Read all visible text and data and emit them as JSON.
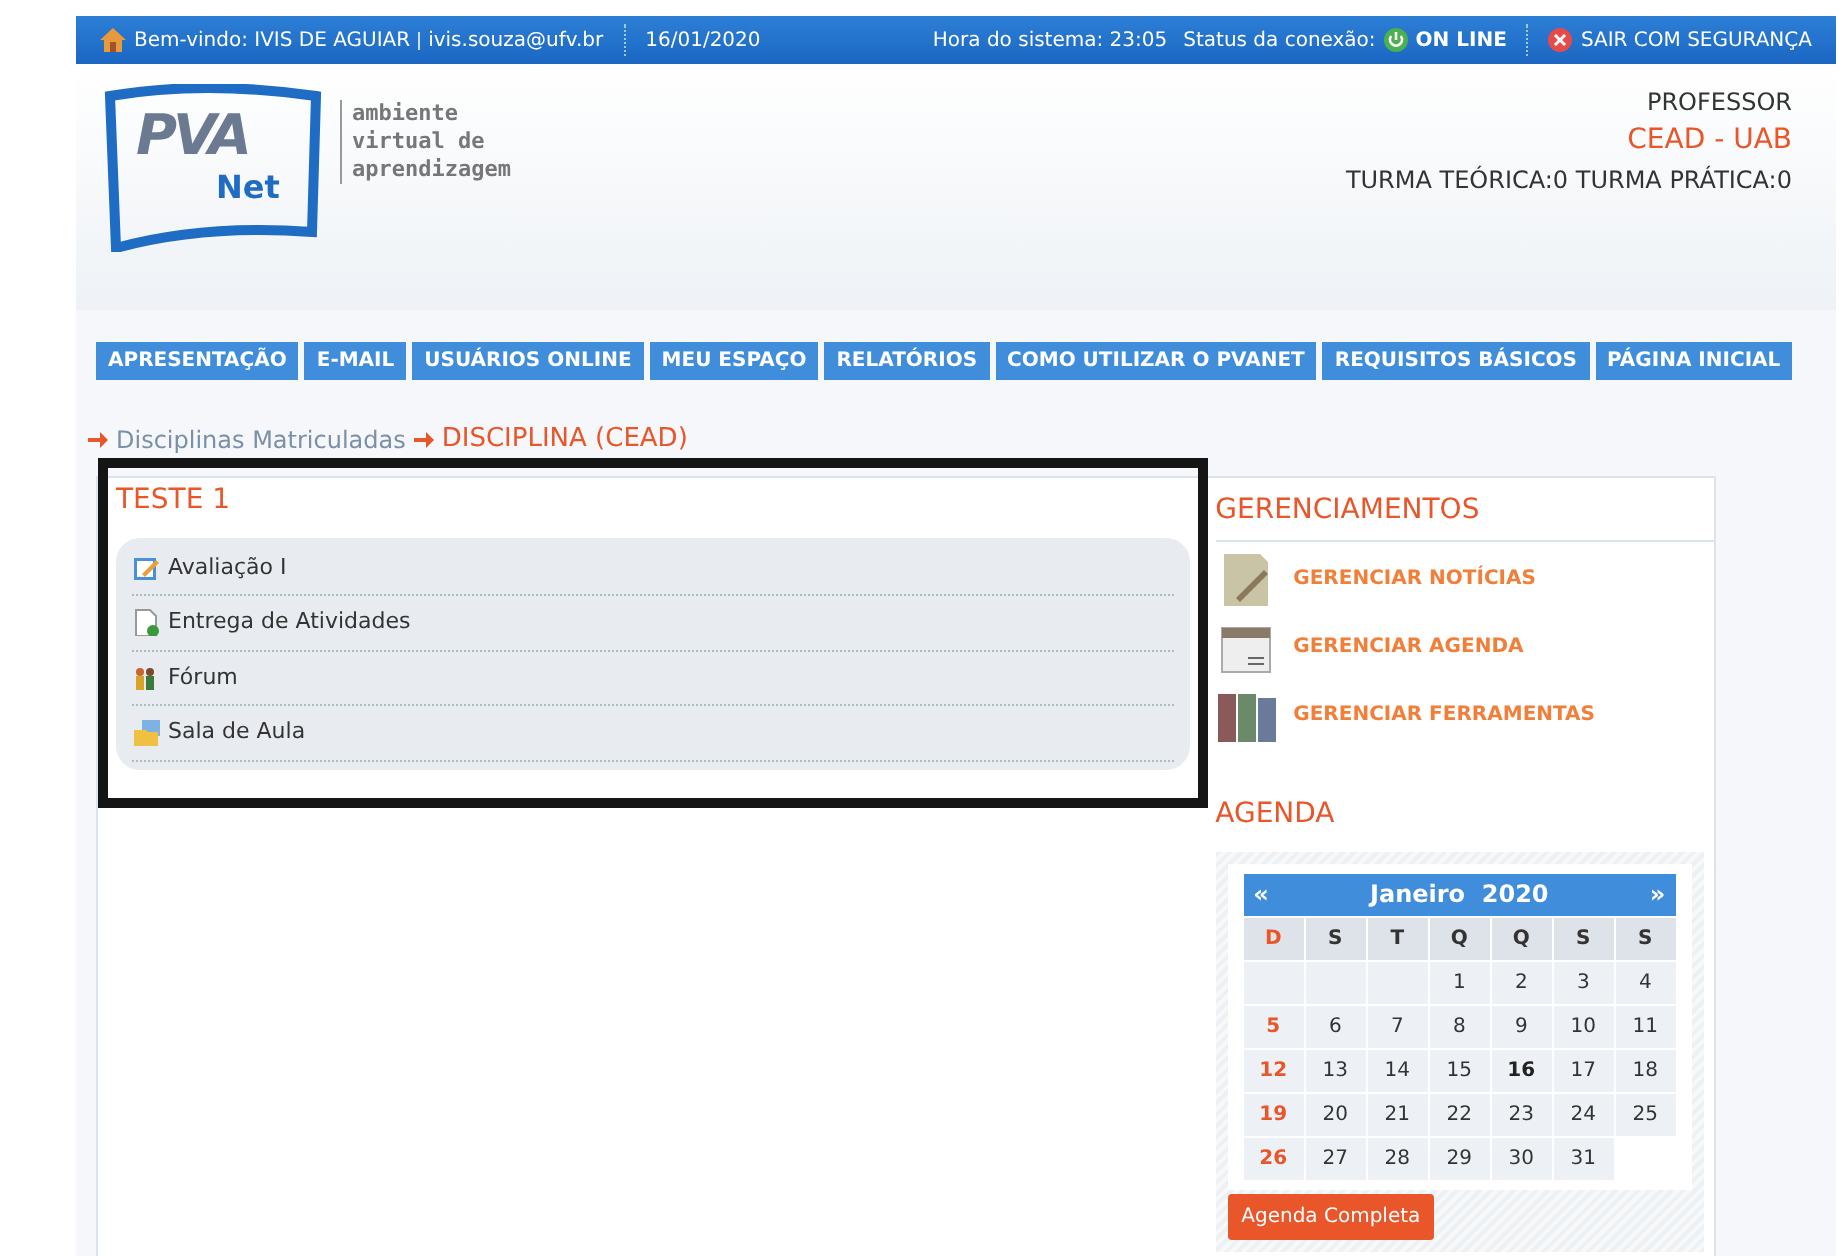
{
  "top_bar": {
    "welcome": "Bem-vindo: IVIS DE AGUIAR",
    "email": "ivis.souza@ufv.br",
    "date": "16/01/2020",
    "system_time": "Hora do sistema: 23:05",
    "connection_label": "Status da conexão:",
    "connection_status": "ON LINE",
    "online": true,
    "logout": "SAIR COM SEGURANÇA"
  },
  "header": {
    "logo_text": "PVA",
    "logo_sub": "Net",
    "tagline": [
      "ambiente",
      "virtual de",
      "aprendizagem"
    ],
    "role": "PROFESSOR",
    "unit": "CEAD - UAB",
    "classes": "TURMA TEÓRICA:0 TURMA PRÁTICA:0"
  },
  "nav": [
    "APRESENTAÇÃO",
    "E-MAIL",
    "USUÁRIOS ONLINE",
    "MEU ESPAÇO",
    "RELATÓRIOS",
    "COMO UTILIZAR O PVANET",
    "REQUISITOS BÁSICOS",
    "PÁGINA INICIAL"
  ],
  "breadcrumb": [
    {
      "label": "Disciplinas Matriculadas",
      "current": false
    },
    {
      "label": "DISCIPLINA (CEAD)",
      "current": true
    }
  ],
  "course": {
    "title": "TESTE 1",
    "items": [
      {
        "label": "Avaliação I",
        "kind": "evaluation"
      },
      {
        "label": "Entrega de Atividades",
        "kind": "upload"
      },
      {
        "label": "Fórum",
        "kind": "forum"
      },
      {
        "label": "Sala de Aula",
        "kind": "classroom"
      }
    ]
  },
  "management": {
    "title": "GERENCIAMENTOS",
    "items": [
      {
        "label": "GERENCIAR NOTÍCIAS",
        "kind": "news"
      },
      {
        "label": "GERENCIAR AGENDA",
        "kind": "calendar"
      },
      {
        "label": "GERENCIAR FERRAMENTAS",
        "kind": "tools"
      }
    ]
  },
  "agenda": {
    "title": "AGENDA",
    "prev": "«",
    "next": "»",
    "month": "Janeiro",
    "year": "2020",
    "weekdays": [
      {
        "label": "D",
        "sunday": true
      },
      {
        "label": "S",
        "sunday": false
      },
      {
        "label": "T",
        "sunday": false
      },
      {
        "label": "Q",
        "sunday": false
      },
      {
        "label": "Q",
        "sunday": false
      },
      {
        "label": "S",
        "sunday": false
      },
      {
        "label": "S",
        "sunday": false
      }
    ],
    "weeks": [
      [
        {
          "kind": "blank"
        },
        {
          "kind": "blank"
        },
        {
          "kind": "blank"
        },
        {
          "kind": "day",
          "day": "1",
          "today": false
        },
        {
          "day": "2",
          "today": false
        },
        {
          "day": "3",
          "today": false
        },
        {
          "day": "4",
          "today": false
        }
      ],
      [
        {
          "day": "5",
          "today": false
        },
        {
          "day": "6",
          "today": false
        },
        {
          "day": "7",
          "today": false
        },
        {
          "day": "8",
          "today": false
        },
        {
          "day": "9",
          "today": false
        },
        {
          "day": "10",
          "today": false
        },
        {
          "day": "11",
          "today": false
        }
      ],
      [
        {
          "day": "12",
          "today": false
        },
        {
          "day": "13",
          "today": false
        },
        {
          "day": "14",
          "today": false
        },
        {
          "day": "15",
          "today": false
        },
        {
          "day": "16",
          "today": true
        },
        {
          "day": "17",
          "today": false
        },
        {
          "day": "18",
          "today": false
        }
      ],
      [
        {
          "day": "19",
          "today": false
        },
        {
          "day": "20",
          "today": false
        },
        {
          "day": "21",
          "today": false
        },
        {
          "day": "22",
          "today": false
        },
        {
          "day": "23",
          "today": false
        },
        {
          "day": "24",
          "today": false
        },
        {
          "day": "25",
          "today": false
        }
      ],
      [
        {
          "day": "26",
          "today": false
        },
        {
          "day": "27",
          "today": false
        },
        {
          "day": "28",
          "today": false
        },
        {
          "day": "29",
          "today": false
        },
        {
          "day": "30",
          "today": false
        },
        {
          "day": "31",
          "today": false
        },
        {
          "kind": "blank"
        }
      ]
    ],
    "button": "Agenda Completa"
  }
}
